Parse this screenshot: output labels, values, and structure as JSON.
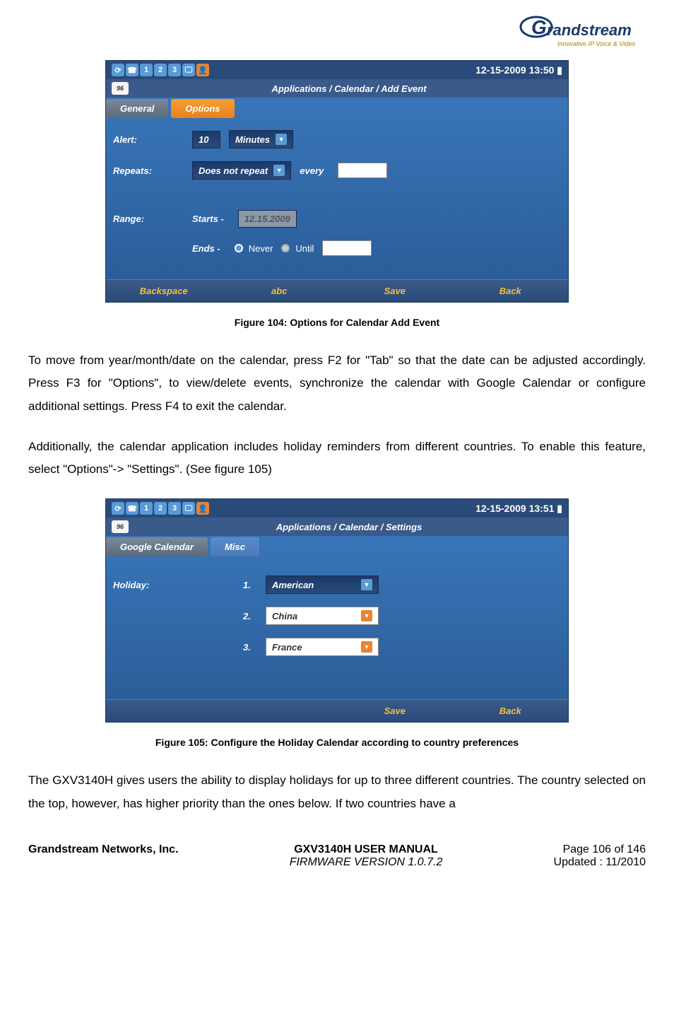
{
  "logo": {
    "brand": "Grandstream",
    "tagline": "Innovative IP Voice & Video"
  },
  "screenshot1": {
    "datetime": "12-15-2009 13:50",
    "status_numbers": [
      "1",
      "2",
      "3"
    ],
    "titlebar_icon": "96",
    "title": "Applications / Calendar / Add Event",
    "tabs": {
      "general": "General",
      "options": "Options"
    },
    "alert": {
      "label": "Alert:",
      "value": "10",
      "unit": "Minutes"
    },
    "repeats": {
      "label": "Repeats:",
      "value": "Does not repeat",
      "every_label": "every"
    },
    "range": {
      "label": "Range:",
      "starts_label": "Starts -",
      "starts_value": "12.15.2009",
      "ends_label": "Ends -",
      "never": "Never",
      "until": "Until"
    },
    "softkeys": {
      "k1": "Backspace",
      "k2": "abc",
      "k3": "Save",
      "k4": "Back"
    }
  },
  "caption1": "Figure 104: Options for Calendar Add Event",
  "para1": "To move from year/month/date on the calendar, press F2 for \"Tab\" so that the date can be adjusted accordingly. Press F3 for \"Options\", to view/delete events, synchronize the calendar with Google Calendar or configure additional settings. Press F4 to exit the calendar.",
  "para2": "Additionally, the calendar application includes holiday reminders from different countries. To enable this feature, select \"Options\"-> \"Settings\". (See figure 105)",
  "screenshot2": {
    "datetime": "12-15-2009 13:51",
    "status_numbers": [
      "1",
      "2",
      "3"
    ],
    "titlebar_icon": "96",
    "title": "Applications / Calendar / Settings",
    "tabs": {
      "google": "Google Calendar",
      "misc": "Misc"
    },
    "holiday": {
      "label": "Holiday:",
      "n1": "1.",
      "v1": "American",
      "n2": "2.",
      "v2": "China",
      "n3": "3.",
      "v3": "France"
    },
    "softkeys": {
      "k3": "Save",
      "k4": "Back"
    }
  },
  "caption2": "Figure 105: Configure the Holiday Calendar according to country preferences",
  "para3": "The GXV3140H gives users the ability to display holidays for up to three different countries. The country selected on the top, however, has higher priority than the ones below. If two countries have a",
  "footer": {
    "company": "Grandstream Networks, Inc.",
    "manual": "GXV3140H USER MANUAL",
    "firmware": "FIRMWARE VERSION 1.0.7.2",
    "page": "Page 106 of 146",
    "updated": "Updated : 11/2010"
  }
}
